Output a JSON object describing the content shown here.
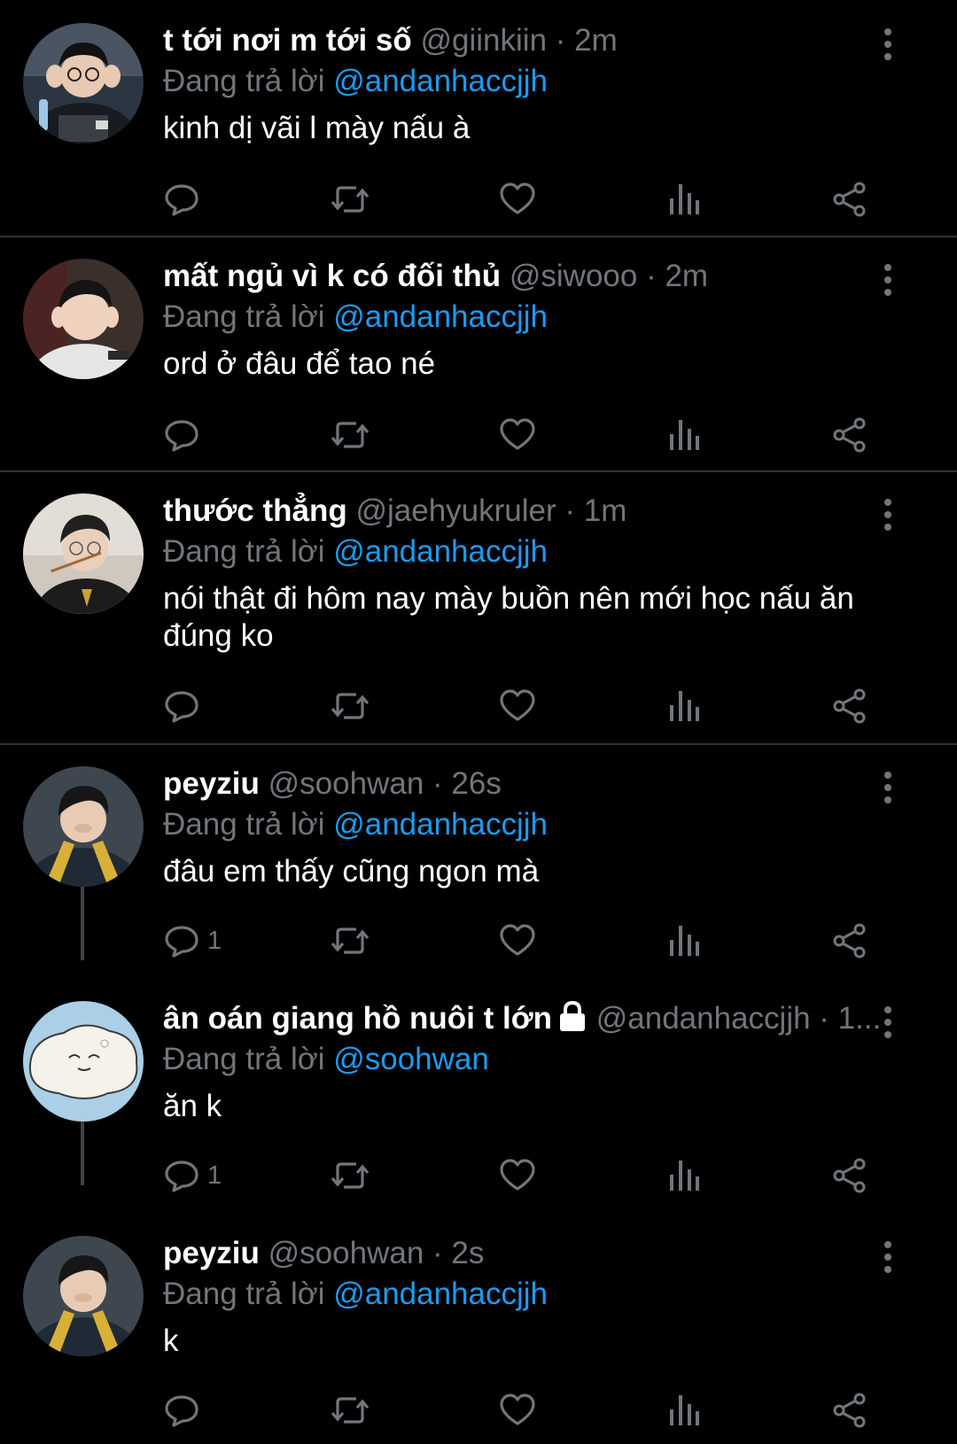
{
  "colors": {
    "background": "#000000",
    "text": "#ffffff",
    "muted": "#71767b",
    "link": "#1d9bf0",
    "divider": "#2f3336"
  },
  "reply_prefix": "Đang trả lời",
  "tweets": [
    {
      "name": "t tới nơi m tới số",
      "handle": "@giinkiin",
      "time": "· 2m",
      "reply_to": "@andanhaccjjh",
      "text": "kinh dị vãi l mày nấu à",
      "reply_count": ""
    },
    {
      "name": "mất ngủ vì k có đối thủ",
      "handle": "@siwooo",
      "time": "· 2m",
      "reply_to": "@andanhaccjjh",
      "text": "ord ở đâu để tao né",
      "reply_count": ""
    },
    {
      "name": "thước thẳng",
      "handle": "@jaehyukruler",
      "time": "· 1m",
      "reply_to": "@andanhaccjjh",
      "text": "nói thật đi hôm nay mày buồn nên mới học nấu ăn đúng ko",
      "reply_count": ""
    },
    {
      "name": "peyziu",
      "handle": "@soohwan",
      "time": "· 26s",
      "reply_to": "@andanhaccjjh",
      "text": "đâu em thấy cũng ngon mà",
      "reply_count": "1"
    },
    {
      "name": "ân oán giang hồ nuôi t lớn",
      "handle": "@andanhaccjjh",
      "time": "· 1...",
      "reply_to": "@soohwan",
      "text": "ăn k",
      "reply_count": "1"
    },
    {
      "name": "peyziu",
      "handle": "@soohwan",
      "time": "· 2s",
      "reply_to": "@andanhaccjjh",
      "text": "k",
      "reply_count": ""
    }
  ]
}
